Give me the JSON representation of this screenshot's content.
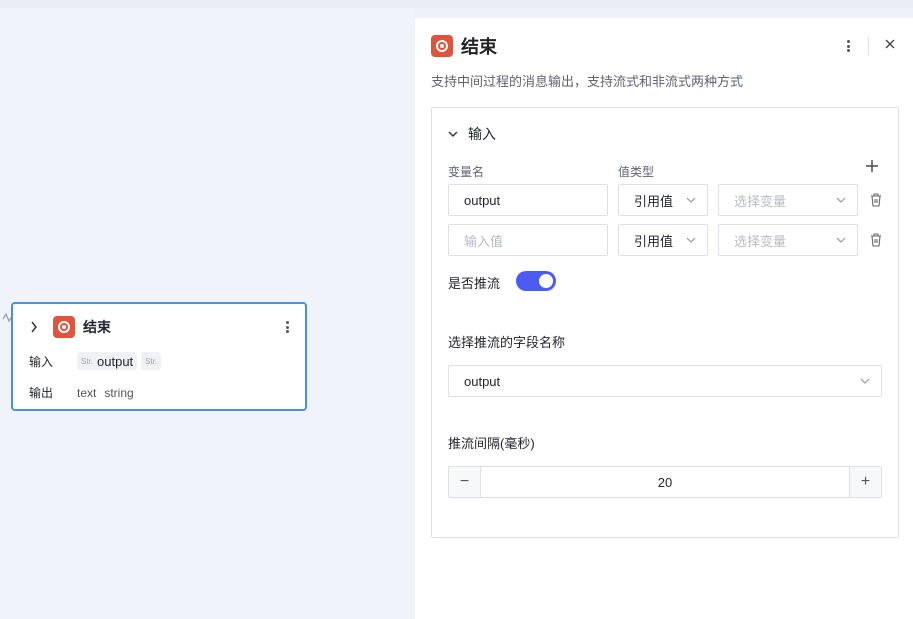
{
  "node": {
    "title": "结束",
    "input_label": "输入",
    "output_label": "输出",
    "input_chip_tag": "Str.",
    "input_chip_value": "output",
    "input_chip2_tag": "Str.",
    "output_value": "text",
    "output_type": "string"
  },
  "panel": {
    "title": "结束",
    "description": "支持中间过程的消息输出，支持流式和非流式两种方式",
    "section_title": "输入",
    "col_var_name": "变量名",
    "col_value_type": "值类型",
    "rows": [
      {
        "name_value": "output",
        "name_placeholder": "输入值",
        "type": "引用值",
        "var_placeholder": "选择变量"
      },
      {
        "name_value": "",
        "name_placeholder": "输入值",
        "type": "引用值",
        "var_placeholder": "选择变量"
      }
    ],
    "stream_toggle_label": "是否推流",
    "stream_toggle_on": true,
    "stream_field_label": "选择推流的字段名称",
    "stream_field_value": "output",
    "interval_label": "推流间隔(毫秒)",
    "interval_value": "20",
    "minus": "−",
    "plus": "+"
  },
  "colors": {
    "accent": "#4d5cf0",
    "node_border": "#4a90e2",
    "end_icon": "#e0533c"
  }
}
